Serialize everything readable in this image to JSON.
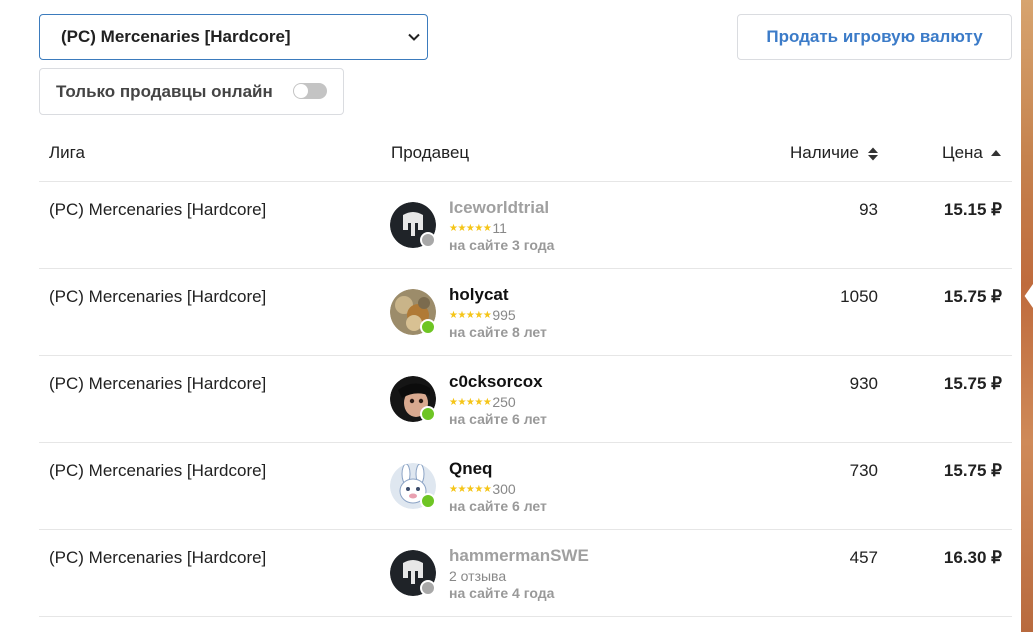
{
  "filters": {
    "league_select_value": "(PC) Mercenaries [Hardcore]",
    "sell_button_label": "Продать игровую валюту",
    "online_only_label": "Только продавцы онлайн",
    "online_only_enabled": false
  },
  "table": {
    "headers": {
      "league": "Лига",
      "seller": "Продавец",
      "stock": "Наличие",
      "price": "Цена"
    },
    "rows": [
      {
        "league": "(PC) Mercenaries [Hardcore]",
        "seller": "Iceworldtrial",
        "online": false,
        "avatar": "helmet-avatar",
        "rating_count": "11",
        "reviews_text": "",
        "since": "на сайте 3 года",
        "stock": "93",
        "price": "15.15 ₽"
      },
      {
        "league": "(PC) Mercenaries [Hardcore]",
        "seller": "holycat",
        "online": true,
        "avatar": "cat-avatar",
        "rating_count": "995",
        "reviews_text": "",
        "since": "на сайте 8 лет",
        "stock": "1050",
        "price": "15.75 ₽"
      },
      {
        "league": "(PC) Mercenaries [Hardcore]",
        "seller": "c0cksorcox",
        "online": true,
        "avatar": "face-avatar",
        "rating_count": "250",
        "reviews_text": "",
        "since": "на сайте 6 лет",
        "stock": "930",
        "price": "15.75 ₽"
      },
      {
        "league": "(PC) Mercenaries [Hardcore]",
        "seller": "Qneq",
        "online": true,
        "avatar": "rabbit-avatar",
        "rating_count": "300",
        "reviews_text": "",
        "since": "на сайте 6 лет",
        "stock": "730",
        "price": "15.75 ₽"
      },
      {
        "league": "(PC) Mercenaries [Hardcore]",
        "seller": "hammermanSWE",
        "online": false,
        "avatar": "helmet-avatar",
        "rating_count": "",
        "reviews_text": "2 отзыва",
        "since": "на сайте 4 года",
        "stock": "457",
        "price": "16.30 ₽"
      }
    ]
  },
  "colors": {
    "accent_blue": "#3b7bc8",
    "online_green": "#6ec524",
    "offline_gray": "#a8a8a8",
    "star_yellow": "#f5c518"
  }
}
